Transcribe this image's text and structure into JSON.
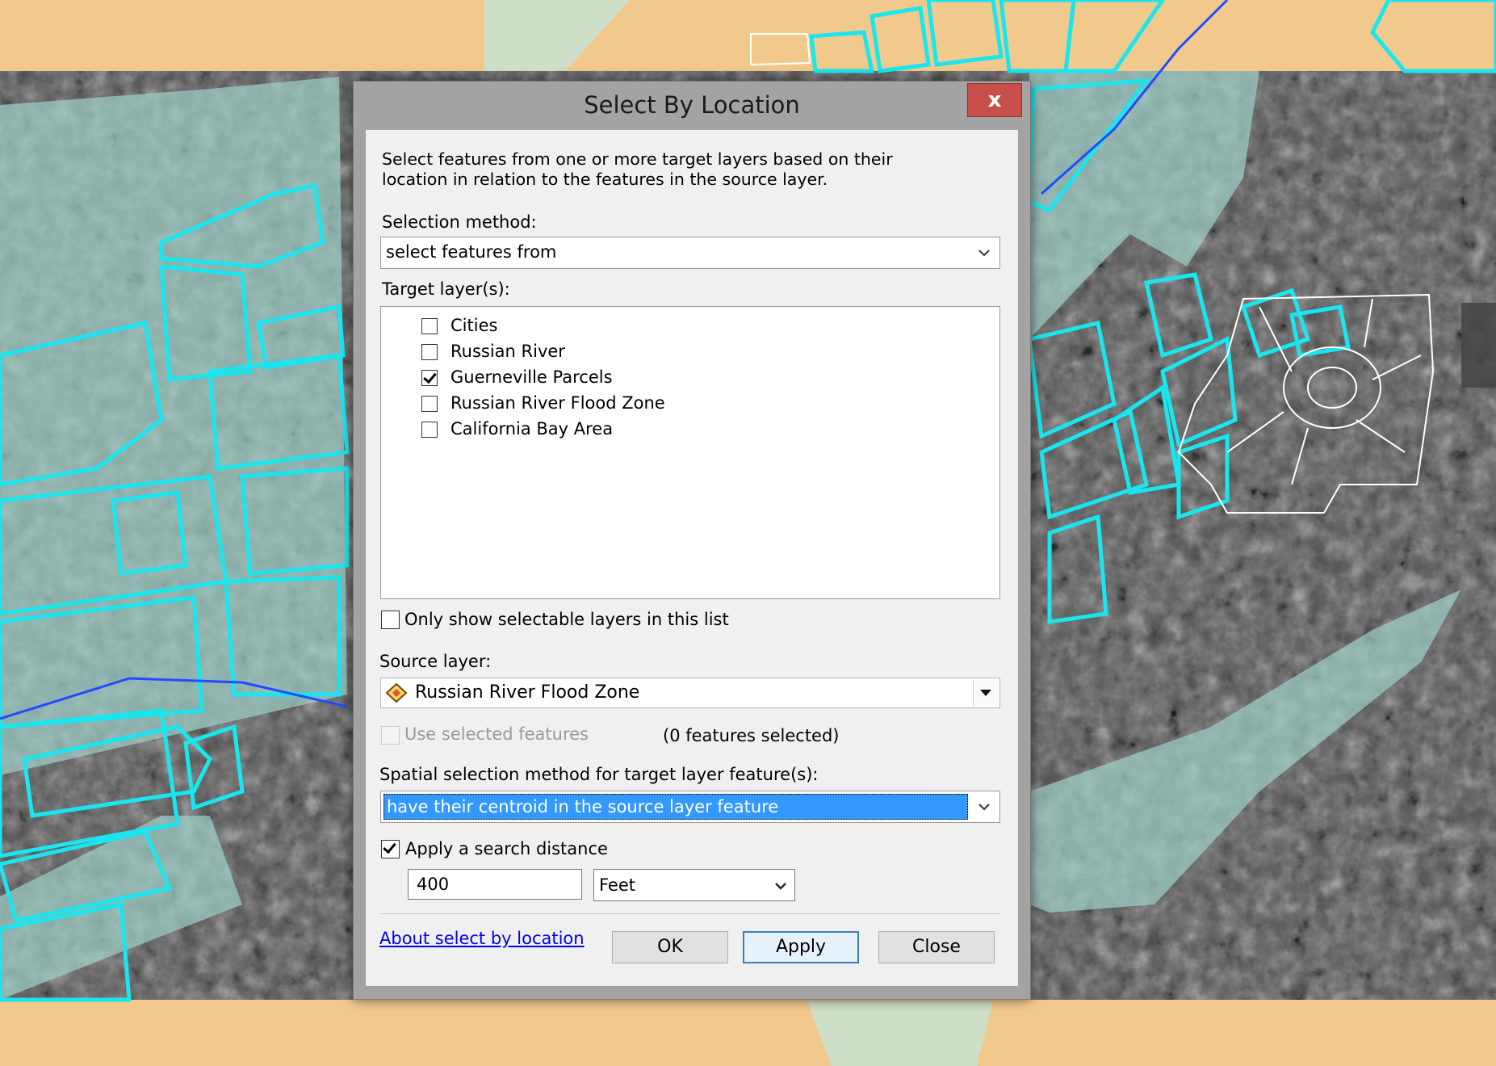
{
  "dialog": {
    "title": "Select By Location",
    "close_glyph": "x",
    "description": "Select features from one or more target layers based on their location in relation to the features in the source layer.",
    "selection_method_label": "Selection method:",
    "selection_method_value": "select features from",
    "target_layers_label": "Target layer(s):",
    "target_layers": [
      {
        "name": "Cities",
        "checked": false
      },
      {
        "name": "Russian River",
        "checked": false
      },
      {
        "name": "Guerneville Parcels",
        "checked": true
      },
      {
        "name": "Russian River Flood Zone",
        "checked": false
      },
      {
        "name": "California Bay Area",
        "checked": false
      }
    ],
    "only_selectable_label": "Only show selectable layers in this list",
    "only_selectable_checked": false,
    "source_layer_label": "Source layer:",
    "source_layer_value": "Russian River Flood Zone",
    "source_layer_icon": "polygon-layer-icon",
    "use_selected_label": "Use selected features",
    "use_selected_checked": false,
    "features_selected_text": "(0 features selected)",
    "spatial_method_label": "Spatial selection method for target layer feature(s):",
    "spatial_method_value": "have their centroid in the source layer feature",
    "apply_distance_label": "Apply a search distance",
    "apply_distance_checked": true,
    "distance_value": "400",
    "distance_unit": "Feet",
    "about_link": "About select by location",
    "ok_label": "OK",
    "apply_label": "Apply",
    "close_label": "Close"
  },
  "colors": {
    "map_tan": "#f2c98d",
    "flood_zone": "#9fcfc8",
    "parcels": "#19e6ee",
    "title_close": "#c9504a",
    "highlight": "#3399ff",
    "link": "#0000ee"
  }
}
